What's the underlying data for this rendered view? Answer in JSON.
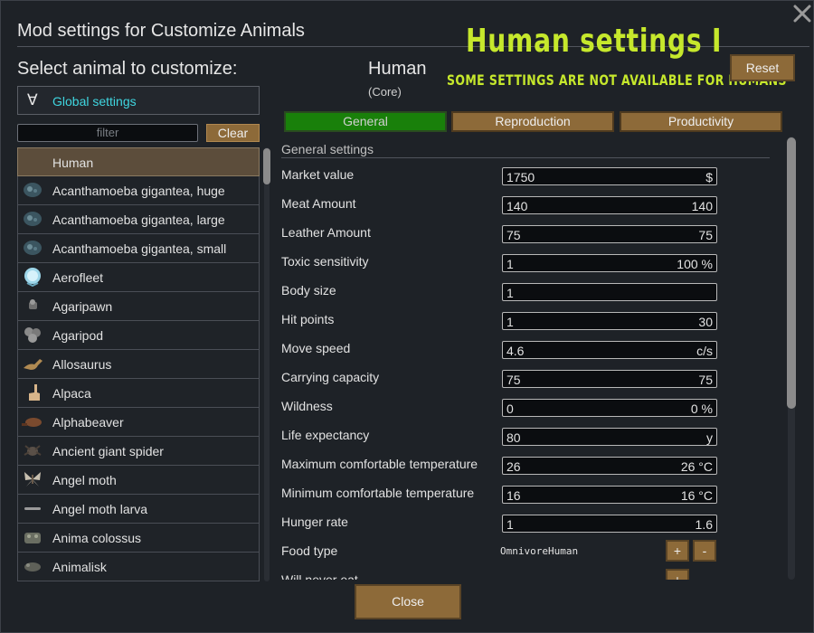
{
  "window": {
    "title": "Mod settings for Customize Animals",
    "close_icon": "close-x-icon"
  },
  "overlay": {
    "title": "Human settings I",
    "subtitle": "SOME SETTINGS ARE NOT AVAILABLE FOR HUMANS",
    "color": "#c6e82c"
  },
  "left": {
    "label": "Select animal to customize:",
    "global": {
      "symbol": "∀",
      "label": "Global settings",
      "color": "#3fd6e0"
    },
    "filter_placeholder": "filter",
    "clear_label": "Clear",
    "animals": [
      {
        "name": "Human",
        "icon": "none",
        "selected": true
      },
      {
        "name": "Acanthamoeba gigantea, huge",
        "icon": "amoeba-icon"
      },
      {
        "name": "Acanthamoeba gigantea, large",
        "icon": "amoeba-icon"
      },
      {
        "name": "Acanthamoeba gigantea, small",
        "icon": "amoeba-icon"
      },
      {
        "name": "Aerofleet",
        "icon": "aerofleet-icon"
      },
      {
        "name": "Agaripawn",
        "icon": "agaripawn-icon"
      },
      {
        "name": "Agaripod",
        "icon": "agaripod-icon"
      },
      {
        "name": "Allosaurus",
        "icon": "allosaurus-icon"
      },
      {
        "name": "Alpaca",
        "icon": "alpaca-icon"
      },
      {
        "name": "Alphabeaver",
        "icon": "alphabeaver-icon"
      },
      {
        "name": "Ancient giant spider",
        "icon": "spider-icon"
      },
      {
        "name": "Angel moth",
        "icon": "moth-icon"
      },
      {
        "name": "Angel moth larva",
        "icon": "larva-icon"
      },
      {
        "name": "Anima colossus",
        "icon": "colossus-icon"
      },
      {
        "name": "Animalisk",
        "icon": "animalisk-icon"
      }
    ]
  },
  "main": {
    "animal_name": "Human",
    "animal_source": "(Core)",
    "reset_label": "Reset",
    "tabs": [
      {
        "label": "General",
        "active": true
      },
      {
        "label": "Reproduction",
        "active": false
      },
      {
        "label": "Productivity",
        "active": false
      }
    ],
    "section_title": "General settings",
    "settings": [
      {
        "label": "Market value",
        "value": "1750",
        "unit": "$"
      },
      {
        "label": "Meat Amount",
        "value": "140",
        "unit": "140"
      },
      {
        "label": "Leather Amount",
        "value": "75",
        "unit": "75"
      },
      {
        "label": "Toxic sensitivity",
        "value": "1",
        "unit": "100 %"
      },
      {
        "label": "Body size",
        "value": "1",
        "unit": ""
      },
      {
        "label": "Hit points",
        "value": "1",
        "unit": "30"
      },
      {
        "label": "Move speed",
        "value": "4.6",
        "unit": "c/s"
      },
      {
        "label": "Carrying capacity",
        "value": "75",
        "unit": "75"
      },
      {
        "label": "Wildness",
        "value": "0",
        "unit": "0 %"
      },
      {
        "label": "Life expectancy",
        "value": "80",
        "unit": "y"
      },
      {
        "label": "Maximum comfortable temperature",
        "value": "26",
        "unit": "26 °C"
      },
      {
        "label": "Minimum comfortable temperature",
        "value": "16",
        "unit": "16 °C"
      },
      {
        "label": "Hunger rate",
        "value": "1",
        "unit": "1.6"
      }
    ],
    "food_type": {
      "label": "Food type",
      "value": "OmnivoreHuman",
      "plus": "+",
      "minus": "-"
    },
    "never_eat": {
      "label": "Will never eat",
      "plus": "+"
    }
  },
  "footer": {
    "close_label": "Close"
  },
  "colors": {
    "button": "#8d6a39",
    "active_tab": "#19800a",
    "selected_row": "#5c4d3b",
    "background": "#1e2227"
  }
}
